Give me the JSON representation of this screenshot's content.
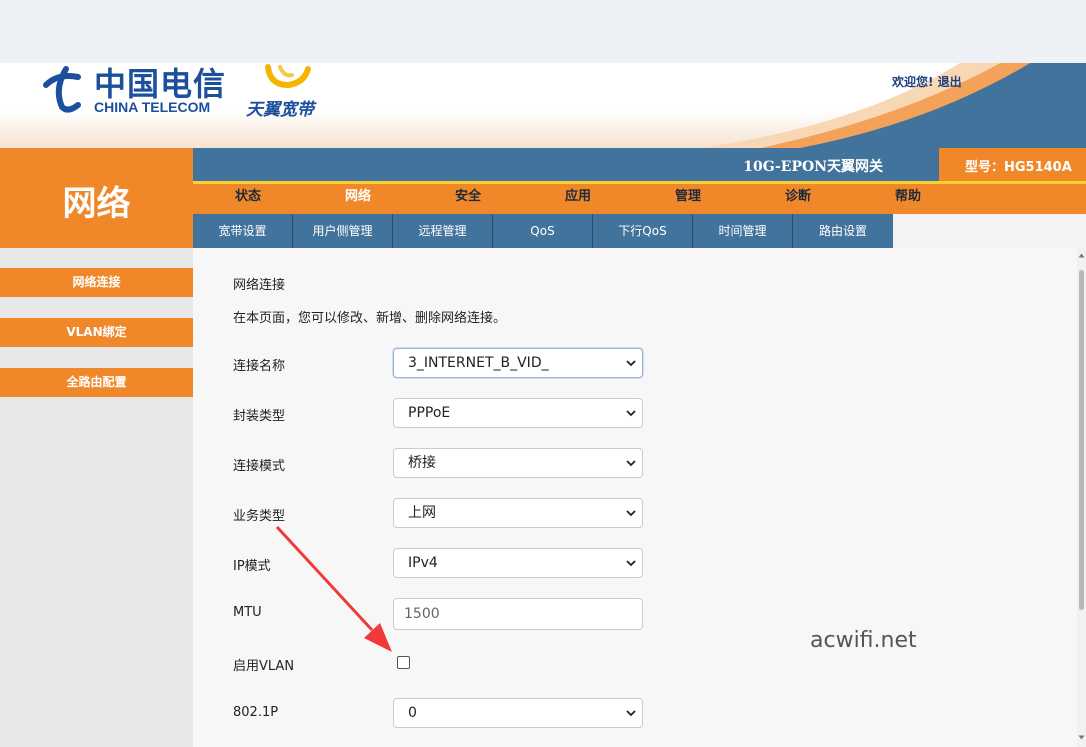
{
  "header": {
    "brand_cn": "中国电信",
    "brand_en": "CHINA TELECOM",
    "sub_brand": "天翼宽带",
    "welcome": "欢迎您!",
    "logout": "退出"
  },
  "section_title": "网络",
  "device": {
    "name": "10G-EPON天翼网关",
    "model": "型号：HG5140A"
  },
  "main_nav": [
    "状态",
    "网络",
    "安全",
    "应用",
    "管理",
    "诊断",
    "帮助"
  ],
  "sub_nav": [
    "宽带设置",
    "用户侧管理",
    "远程管理",
    "QoS",
    "下行QoS",
    "时间管理",
    "路由设置"
  ],
  "sidebar": [
    "网络连接",
    "VLAN绑定",
    "全路由配置"
  ],
  "content": {
    "title": "网络连接",
    "description": "在本页面，您可以修改、新增、删除网络连接。",
    "fields": {
      "connection_name": {
        "label": "连接名称",
        "value": "3_INTERNET_B_VID_"
      },
      "encapsulation": {
        "label": "封装类型",
        "value": "PPPoE"
      },
      "connection_mode": {
        "label": "连接模式",
        "value": "桥接"
      },
      "service_type": {
        "label": "业务类型",
        "value": "上网"
      },
      "ip_mode": {
        "label": "IP模式",
        "value": "IPv4"
      },
      "mtu": {
        "label": "MTU",
        "value": "1500"
      },
      "enable_vlan": {
        "label": "启用VLAN",
        "checked": false
      },
      "dot1p": {
        "label": "802.1P",
        "value": "0"
      }
    }
  },
  "watermark": "acwifi.net",
  "colors": {
    "orange": "#f0882a",
    "blue": "#41739c",
    "yellow": "#f8d030",
    "brand_blue": "#1c4f9c"
  }
}
